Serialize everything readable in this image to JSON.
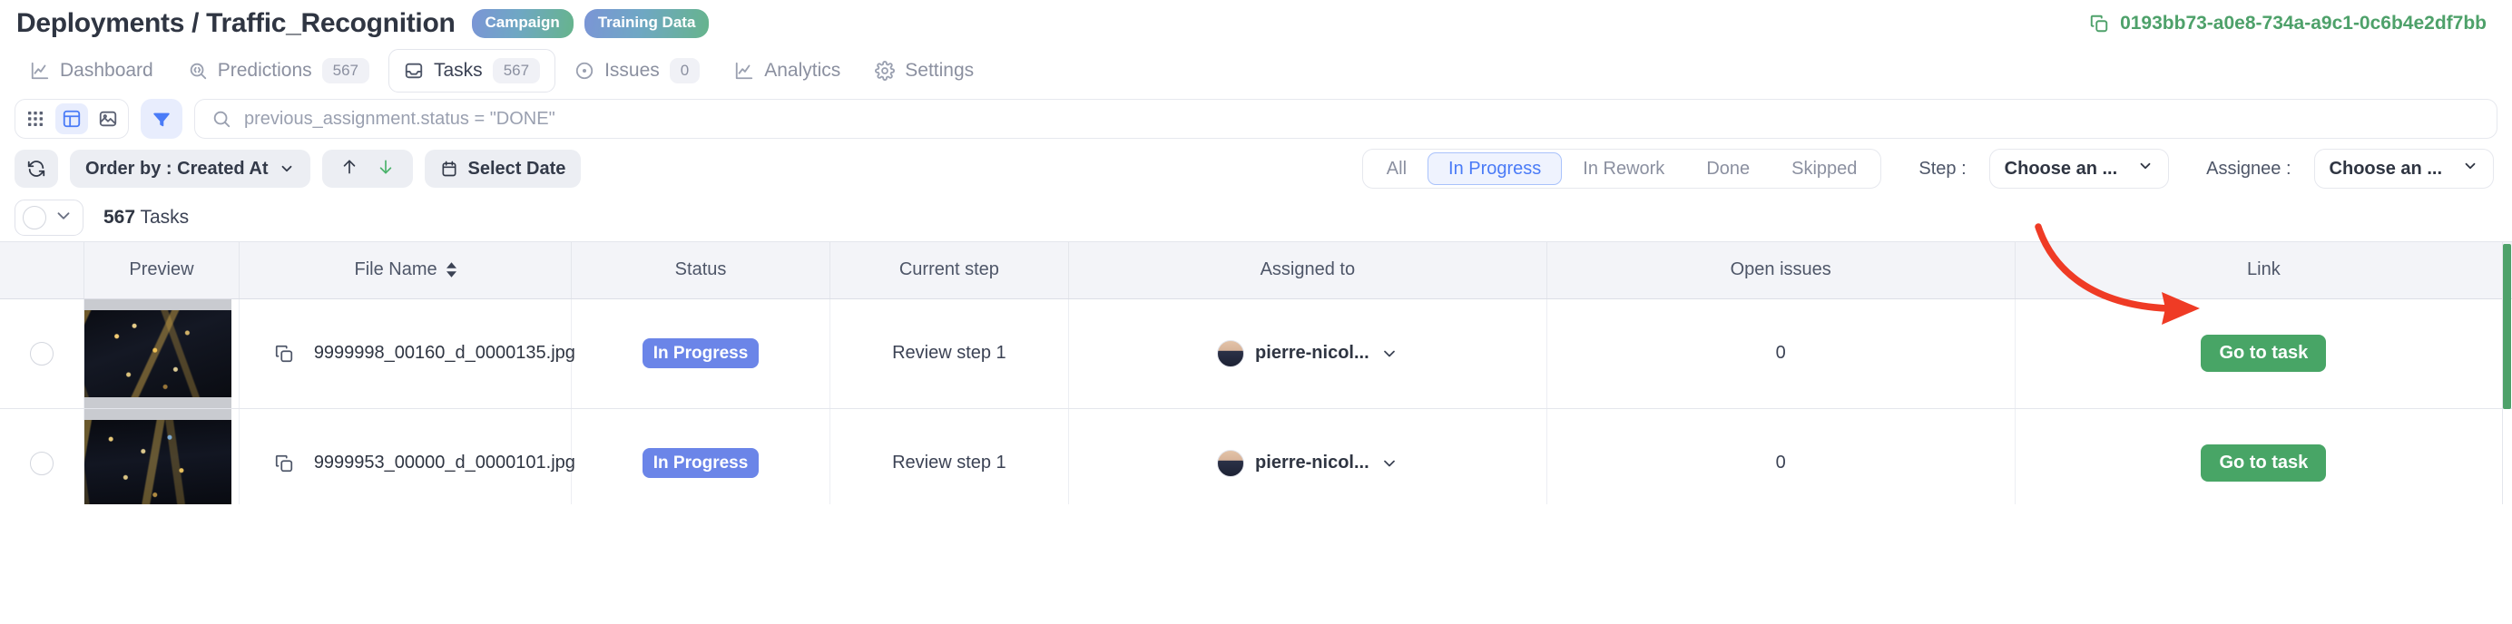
{
  "header": {
    "breadcrumb": "Deployments / Traffic_Recognition",
    "badges": [
      "Campaign",
      "Training Data"
    ],
    "deployment_id": "0193bb73-a0e8-734a-a9c1-0c6b4e2df7bb",
    "copy_icon": "copy-icon",
    "accent_green": "#4ea16a",
    "badge_gradient_from": "#7b95d6",
    "badge_gradient_to": "#66b48c"
  },
  "nav": {
    "tabs": [
      {
        "label": "Dashboard",
        "icon": "chart-line-icon",
        "count": null,
        "active": false
      },
      {
        "label": "Predictions",
        "icon": "target-search-icon",
        "count": "567",
        "active": false
      },
      {
        "label": "Tasks",
        "icon": "inbox-icon",
        "count": "567",
        "active": true
      },
      {
        "label": "Issues",
        "icon": "dot-circle-icon",
        "count": "0",
        "active": false
      },
      {
        "label": "Analytics",
        "icon": "chart-line-icon",
        "count": null,
        "active": false
      },
      {
        "label": "Settings",
        "icon": "gear-icon",
        "count": null,
        "active": false
      }
    ]
  },
  "toolbar": {
    "view_buttons": [
      {
        "name": "grid-view-icon",
        "active": false
      },
      {
        "name": "table-view-icon",
        "active": true
      },
      {
        "name": "image-view-icon",
        "active": false
      }
    ],
    "filter_button": {
      "name": "filter-icon",
      "active": true
    },
    "search": {
      "icon": "search-icon",
      "value": "previous_assignment.status = \"DONE\"",
      "placeholder": "Search"
    },
    "active_blue": "#4a7bf7",
    "active_blue_bg": "#e8edfd"
  },
  "controls": {
    "refresh_icon": "refresh-icon",
    "order_by_label": "Order by : Created At",
    "sort_asc_icon": "arrow-up-icon",
    "sort_desc_icon": "arrow-down-icon",
    "sort_desc_active": true,
    "select_date_label": "Select Date",
    "calendar_icon": "calendar-icon",
    "segments": [
      {
        "label": "All",
        "active": false
      },
      {
        "label": "In Progress",
        "active": true
      },
      {
        "label": "In Rework",
        "active": false
      },
      {
        "label": "Done",
        "active": false
      },
      {
        "label": "Skipped",
        "active": false
      }
    ],
    "step_label": "Step :",
    "step_value": "Choose an ...",
    "assignee_label": "Assignee :",
    "assignee_value": "Choose an ..."
  },
  "count_row": {
    "select_all_icon": "circle-checkbox-icon",
    "select_all_chevron": "chevron-down-icon",
    "count": "567",
    "count_suffix": " Tasks"
  },
  "table": {
    "columns": [
      {
        "key": "check",
        "label": ""
      },
      {
        "key": "preview",
        "label": "Preview"
      },
      {
        "key": "file",
        "label": "File Name",
        "sortable": true
      },
      {
        "key": "status",
        "label": "Status"
      },
      {
        "key": "step",
        "label": "Current step"
      },
      {
        "key": "assign",
        "label": "Assigned to"
      },
      {
        "key": "issues",
        "label": "Open issues"
      },
      {
        "key": "link",
        "label": "Link"
      }
    ],
    "rows": [
      {
        "file_name": "9999998_00160_d_0000135.jpg",
        "status": "In Progress",
        "current_step": "Review step 1",
        "assignee": "pierre-nicol...",
        "open_issues": "0",
        "link_label": "Go to task"
      },
      {
        "file_name": "9999953_00000_d_0000101.jpg",
        "status": "In Progress",
        "current_step": "Review step 1",
        "assignee": "pierre-nicol...",
        "open_issues": "0",
        "link_label": "Go to task"
      }
    ],
    "status_color": "#6b85e8",
    "link_button_color": "#48a566",
    "scrollbar_color": "#4ea16a"
  },
  "annotation": {
    "arrow": "red-curved-arrow",
    "color": "#ef3b25"
  }
}
